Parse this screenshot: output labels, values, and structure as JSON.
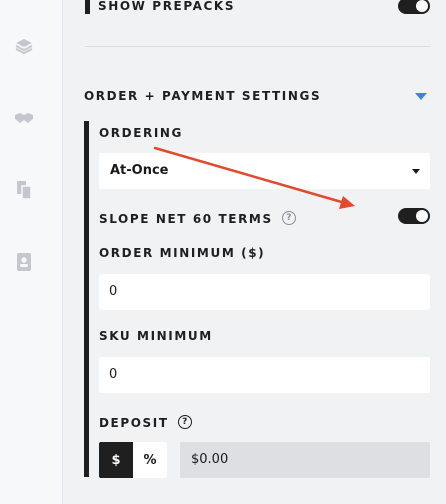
{
  "sidebar": {
    "icons": [
      "layers-icon",
      "handshake-icon",
      "documents-icon",
      "contact-card-icon"
    ]
  },
  "top": {
    "show_prepacks_label": "SHOW PREPACKS",
    "show_prepacks_on": true
  },
  "section": {
    "title": "ORDER + PAYMENT SETTINGS",
    "caret_color": "#3c86d6"
  },
  "fields": {
    "ordering_label": "ORDERING",
    "ordering_value": "At-Once",
    "terms_label": "SLOPE NET 60 TERMS",
    "terms_on": true,
    "order_min_label": "ORDER MINIMUM ($)",
    "order_min_value": "0",
    "sku_min_label": "SKU MINIMUM",
    "sku_min_value": "0",
    "deposit_label": "DEPOSIT",
    "deposit_dollar": "$",
    "deposit_percent": "%",
    "deposit_value": "$0.00",
    "help_glyph": "?"
  },
  "annotation": {
    "arrow_color": "#e04a2f"
  }
}
